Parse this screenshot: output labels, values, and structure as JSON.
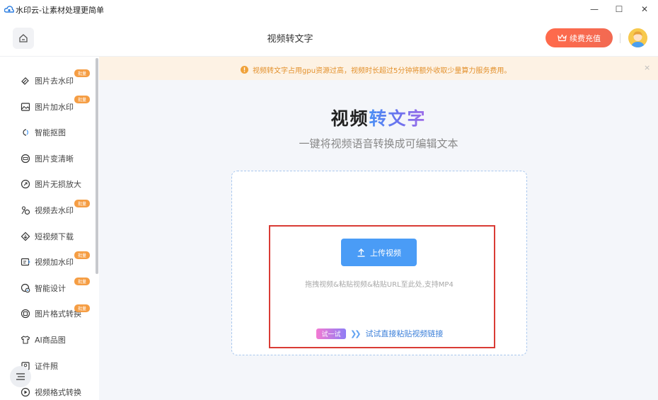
{
  "window": {
    "title": "水印云-让素材处理更简单",
    "controls": {
      "minimize": "—",
      "maximize": "☐",
      "close": "✕"
    }
  },
  "header": {
    "home_icon": "home-icon",
    "page_title": "视频转文字",
    "recharge_label": "续费充值",
    "recharge_color": "#f26a52"
  },
  "notice": {
    "text": "视频转文字占用gpu资源过高，视频时长超过5分钟将额外收取少量算力服务费用。",
    "close": "×",
    "color": "#e3912d"
  },
  "sidebar": {
    "items": [
      {
        "label": "图片去水印",
        "icon": "eraser-icon",
        "badge": "批量"
      },
      {
        "label": "图片加水印",
        "icon": "image-add-icon",
        "badge": "批量"
      },
      {
        "label": "智能抠图",
        "icon": "cutout-icon",
        "badge": ""
      },
      {
        "label": "图片变清晰",
        "icon": "hd-icon",
        "badge": ""
      },
      {
        "label": "图片无损放大",
        "icon": "zoom-icon",
        "badge": ""
      },
      {
        "label": "视频去水印",
        "icon": "video-erase-icon",
        "badge": "批量"
      },
      {
        "label": "短视频下载",
        "icon": "download-icon",
        "badge": ""
      },
      {
        "label": "视频加水印",
        "icon": "video-add-icon",
        "badge": "批量"
      },
      {
        "label": "智能设计",
        "icon": "design-icon",
        "badge": "批量"
      },
      {
        "label": "图片格式转换",
        "icon": "convert-icon",
        "badge": "批量"
      },
      {
        "label": "AI商品图",
        "icon": "shirt-icon",
        "badge": ""
      },
      {
        "label": "证件照",
        "icon": "id-photo-icon",
        "badge": ""
      },
      {
        "label": "视频格式转换",
        "icon": "play-icon",
        "badge": ""
      }
    ],
    "menu_icon": "menu-icon"
  },
  "main": {
    "hero_title_dark": "视频",
    "hero_title_accent": "转文字",
    "hero_subtitle": "一键将视频语音转换成可编辑文本",
    "upload_label": "上传视频",
    "drop_hint": "拖拽视频&粘贴视频&粘贴URL至此处,支持MP4",
    "try_tag": "试一试",
    "try_link": "试试直接粘贴视频链接"
  }
}
